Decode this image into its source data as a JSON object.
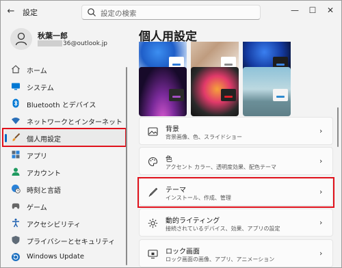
{
  "app": {
    "title": "設定",
    "back_glyph": "←",
    "min_glyph": "—",
    "max_glyph": "☐",
    "close_glyph": "✕"
  },
  "search": {
    "placeholder": "設定の検索"
  },
  "profile": {
    "name": "秋葉一郎",
    "email_suffix": "36@outlook.jp"
  },
  "nav": {
    "items": [
      {
        "label": "ホーム",
        "icon": "home-icon"
      },
      {
        "label": "システム",
        "icon": "monitor-icon"
      },
      {
        "label": "Bluetooth とデバイス",
        "icon": "bluetooth-icon"
      },
      {
        "label": "ネットワークとインターネット",
        "icon": "wifi-icon"
      },
      {
        "label": "個人用設定",
        "icon": "brush-icon",
        "active": true
      },
      {
        "label": "アプリ",
        "icon": "apps-icon"
      },
      {
        "label": "アカウント",
        "icon": "account-icon"
      },
      {
        "label": "時刻と言語",
        "icon": "globe-clock-icon"
      },
      {
        "label": "ゲーム",
        "icon": "gamepad-icon"
      },
      {
        "label": "アクセシビリティ",
        "icon": "accessibility-icon"
      },
      {
        "label": "プライバシーとセキュリティ",
        "icon": "shield-icon"
      },
      {
        "label": "Windows Update",
        "icon": "update-icon"
      }
    ]
  },
  "main": {
    "title": "個人用設定",
    "cards": [
      {
        "title": "背景",
        "subtitle": "背景画像、色、スライドショー",
        "icon": "picture-icon",
        "chevron": "›"
      },
      {
        "title": "色",
        "subtitle": "アクセント カラー、透明度効果、配色テーマ",
        "icon": "palette-icon",
        "chevron": "›"
      },
      {
        "title": "テーマ",
        "subtitle": "インストール、作成、管理",
        "icon": "pen-icon",
        "chevron": "›"
      },
      {
        "title": "動的ライティング",
        "subtitle": "接続されているデバイス、効果、アプリの設定",
        "icon": "sun-icon",
        "chevron": "›"
      },
      {
        "title": "ロック画面",
        "subtitle": "ロック画面の画像、アプリ、アニメーション",
        "icon": "lock-screen-icon",
        "chevron": "›"
      }
    ]
  },
  "colors": {
    "accent": "#0067c0",
    "highlight_frame": "#e0101a"
  }
}
